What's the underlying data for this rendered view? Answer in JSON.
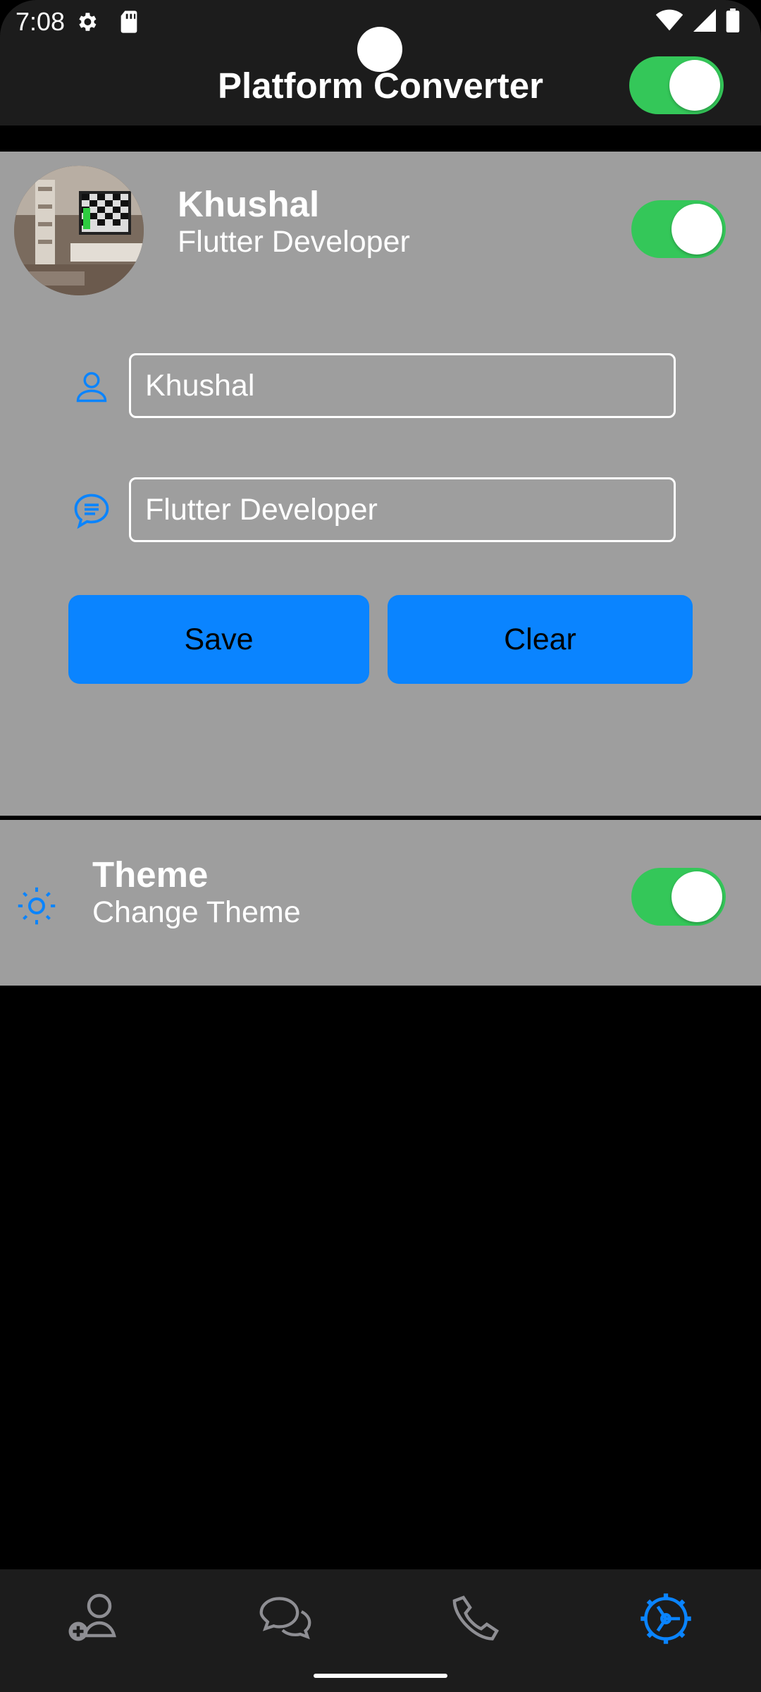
{
  "status_bar": {
    "time": "7:08",
    "icons": [
      "gear-icon",
      "sd-card-icon",
      "wifi-icon",
      "signal-icon",
      "battery-icon"
    ]
  },
  "app_bar": {
    "title": "Platform Converter",
    "platform_toggle_on": true
  },
  "profile": {
    "name": "Khushal",
    "subtitle": "Flutter Developer",
    "toggle_on": true,
    "name_field_value": "Khushal",
    "bio_field_value": "Flutter Developer",
    "save_label": "Save",
    "clear_label": "Clear"
  },
  "theme": {
    "title": "Theme",
    "subtitle": "Change Theme",
    "toggle_on": true
  },
  "bottom_nav": {
    "items": [
      {
        "icon": "add-contact-icon",
        "active": false
      },
      {
        "icon": "chats-icon",
        "active": false
      },
      {
        "icon": "phone-icon",
        "active": false
      },
      {
        "icon": "settings-icon",
        "active": true
      }
    ]
  },
  "colors": {
    "accent": "#0a84ff",
    "toggle_on": "#34c759",
    "panel": "#9e9e9e",
    "bar": "#1c1c1c",
    "inactive_icon": "#8e8e93"
  }
}
